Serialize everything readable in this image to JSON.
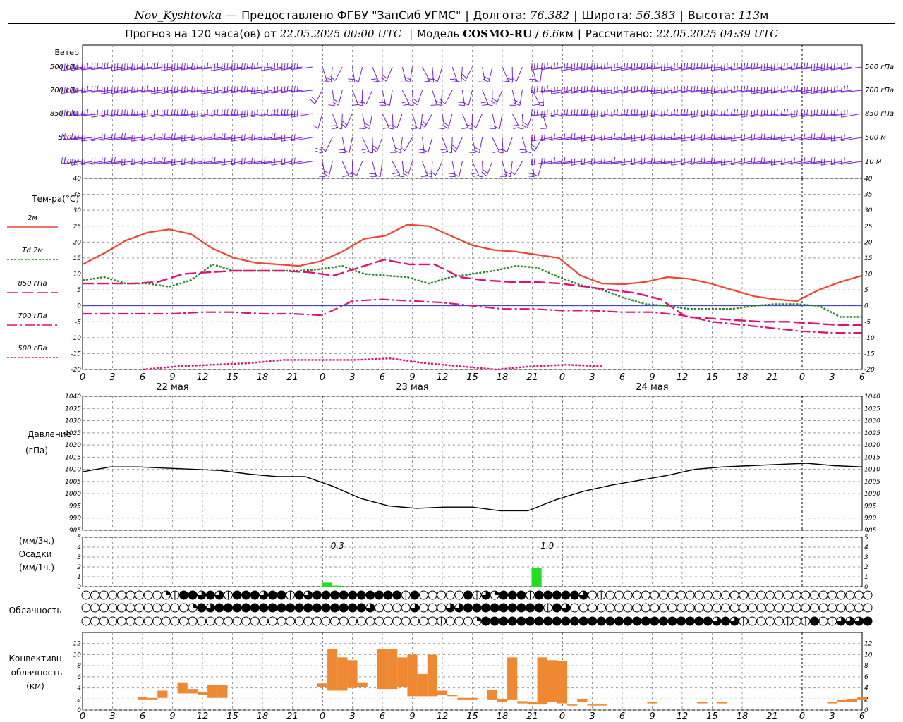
{
  "header": {
    "station": "Nov_Kyshtovka",
    "dash": "—",
    "provider": "Предоставлено ФГБУ \"ЗапСиб УГМС\"",
    "lon_label": "Долгота:",
    "lon_value": "76.382",
    "lat_label": "Широта:",
    "lat_value": "56.383",
    "alt_label": "Высота:",
    "alt_value": "113",
    "alt_unit": "м",
    "forecast_prefix": "Прогноз на 120 часа(ов) от",
    "forecast_start": "22.05.2025 00:00 UTC",
    "model_label": "Модель",
    "model_name": "COSMO-RU",
    "model_res": "6.6",
    "model_res_unit": "км",
    "calc_label": "Рассчитано:",
    "calc_time": "22.05.2025 04:39 UTC"
  },
  "colors": {
    "t2m": "#ee4433",
    "td2m": "#228822",
    "t850": "#dd1177",
    "t700": "#dd1177",
    "t500": "#dd1177",
    "pressure": "#000000",
    "precip": "#22dd22",
    "convective": "#ee8833",
    "wind": "#7722cc",
    "grid": "#999999"
  },
  "chart_data": [
    {
      "type": "line",
      "panel": "wind",
      "title": "Ветер",
      "levels": [
        "500 гПа",
        "700 гПа",
        "850 гПа",
        "500 м",
        "10 м"
      ]
    },
    {
      "type": "line",
      "panel": "temperature",
      "ylabel": "Тем-ра(°C)",
      "ylim": [
        -20,
        40
      ],
      "yticks": [
        40,
        35,
        30,
        25,
        20,
        15,
        10,
        5,
        0,
        -5,
        -10,
        -15,
        -20
      ],
      "x_hours": [
        0,
        3,
        6,
        9,
        12,
        15,
        18,
        21,
        24,
        27,
        30,
        33,
        36,
        39,
        42,
        45,
        48,
        51,
        54,
        57,
        60,
        63,
        66,
        69,
        72,
        75,
        78
      ],
      "x_ticks": [
        "0",
        "3",
        "6",
        "9",
        "12",
        "15",
        "18",
        "21",
        "0",
        "3",
        "6",
        "9",
        "12",
        "15",
        "18",
        "21",
        "0",
        "3",
        "6",
        "9",
        "12",
        "15",
        "18",
        "21",
        "0",
        "3",
        "6"
      ],
      "day_labels": [
        "22 мая",
        "23 мая",
        "24 мая"
      ],
      "series": [
        {
          "name": "2м",
          "values": [
            13,
            16.5,
            20.5,
            23,
            24,
            22.5,
            18,
            15,
            13.5,
            13,
            12.5,
            14,
            17,
            21,
            22,
            25.5,
            25,
            22,
            19,
            17.5,
            17,
            16,
            15,
            9.5,
            7,
            6.8,
            7.5,
            9,
            8.5,
            7,
            5,
            3,
            2,
            1.5,
            5,
            7.5,
            9.5
          ]
        },
        {
          "name": "Td 2м",
          "values": [
            8,
            9,
            7,
            7,
            6,
            8,
            13,
            11,
            11,
            11,
            11,
            11.5,
            12.5,
            10,
            9.5,
            9,
            7,
            9,
            10,
            11,
            12.5,
            12,
            9,
            6.5,
            5,
            2.5,
            0.5,
            0,
            -1,
            -1,
            -1,
            0,
            0.5,
            0.5,
            0,
            -3.5,
            -3.5
          ]
        },
        {
          "name": "850 гПа",
          "values": [
            7,
            7,
            7,
            7.5,
            10,
            10.5,
            11,
            11,
            11,
            10.5,
            9.5,
            12,
            14.5,
            13,
            13,
            9,
            8,
            7.5,
            7.5,
            7,
            6,
            5,
            4,
            2,
            -3.5,
            -4,
            -4.5,
            -5,
            -5,
            -5.5,
            -6,
            -6
          ]
        },
        {
          "name": "700 гПа",
          "values": [
            -2.5,
            -2.5,
            -2.5,
            -2.5,
            -2,
            -2,
            -2.5,
            -2.5,
            -3,
            1.5,
            2,
            1.5,
            1,
            0,
            -1,
            -1,
            -1.5,
            -1.5,
            -2,
            -2,
            -3,
            -5,
            -6,
            -7,
            -8,
            -8.5,
            -8.5
          ]
        },
        {
          "name": "500 гПа",
          "values": [
            -20,
            -19,
            -18.5,
            -18,
            -17,
            -17,
            -17,
            -16.5,
            -18,
            -19,
            -20,
            -19,
            -18.5,
            -19
          ]
        }
      ]
    },
    {
      "type": "line",
      "panel": "pressure",
      "ylabel": "Давление",
      "yunit": "(гПа)",
      "ylim": [
        985,
        1040
      ],
      "yticks": [
        1040,
        1035,
        1030,
        1025,
        1020,
        1015,
        1010,
        1005,
        1000,
        995,
        990,
        985
      ],
      "series": [
        {
          "name": "",
          "values": [
            1009,
            1011,
            1011,
            1010.5,
            1010,
            1009.5,
            1008,
            1007,
            1007,
            1003,
            998,
            995,
            994,
            994.5,
            994.5,
            993,
            993,
            997.5,
            1001,
            1003.5,
            1005.5,
            1007.5,
            1010,
            1011,
            1011.5,
            1012,
            1012.5,
            1011.5,
            1011
          ]
        }
      ]
    },
    {
      "type": "bar",
      "panel": "precipitation",
      "ylabel": "Осадки",
      "unit_3h": "(мм/3ч.)",
      "unit_1h": "(мм/1ч.)",
      "ylim": [
        0,
        5
      ],
      "yticks": [
        5,
        4,
        3,
        2,
        1,
        0
      ],
      "annotations": [
        {
          "hour": 24,
          "text": "0.3"
        },
        {
          "hour": 45,
          "text": "1.9"
        }
      ],
      "bars": [
        {
          "hour": 24,
          "value": 0.4
        },
        {
          "hour": 25,
          "value": 0.1
        },
        {
          "hour": 45,
          "value": 1.9
        }
      ]
    },
    {
      "type": "table",
      "panel": "cloudiness",
      "label": "Облачность",
      "rows": [
        [
          0,
          0,
          0,
          0,
          0,
          0,
          0,
          0,
          0,
          2,
          1,
          4,
          4,
          3,
          4,
          3,
          1,
          4,
          4,
          4,
          3,
          4,
          4,
          1,
          4,
          3,
          4,
          4,
          4,
          4,
          4,
          4,
          4,
          4,
          4,
          4,
          1,
          4,
          0,
          0,
          0,
          0,
          0,
          4,
          1,
          3,
          2,
          4,
          4,
          4,
          1,
          4,
          4,
          4,
          4,
          4,
          3,
          0,
          1,
          0,
          0,
          0,
          0,
          0,
          0,
          0,
          0,
          0,
          0,
          0,
          0,
          0,
          0,
          0,
          0,
          0,
          0,
          0,
          0,
          0,
          0,
          0,
          0,
          0,
          0,
          0,
          0,
          0,
          0
        ],
        [
          0,
          0,
          0,
          0,
          0,
          0,
          0,
          0,
          0,
          0,
          0,
          0,
          2,
          4,
          3,
          4,
          4,
          4,
          4,
          4,
          4,
          4,
          4,
          4,
          4,
          4,
          4,
          4,
          4,
          4,
          4,
          4,
          3,
          0,
          0,
          0,
          0,
          3,
          0,
          0,
          0,
          3,
          3,
          4,
          4,
          4,
          4,
          4,
          4,
          4,
          4,
          4,
          1,
          4,
          3,
          0,
          0,
          0,
          0,
          0,
          0,
          0,
          0,
          0,
          0,
          0,
          0,
          0,
          0,
          0,
          0,
          0,
          0,
          0,
          0,
          0,
          0,
          0,
          0,
          0,
          0,
          0,
          0,
          0,
          0,
          0,
          0,
          0,
          0
        ],
        [
          0,
          0,
          0,
          0,
          0,
          0,
          0,
          0,
          0,
          0,
          0,
          0,
          0,
          0,
          0,
          0,
          0,
          0,
          0,
          0,
          0,
          0,
          0,
          0,
          0,
          0,
          0,
          0,
          0,
          0,
          0,
          0,
          0,
          0,
          0,
          0,
          0,
          0,
          0,
          0,
          1,
          0,
          0,
          0,
          2,
          4,
          4,
          4,
          4,
          4,
          4,
          4,
          4,
          4,
          4,
          4,
          4,
          4,
          4,
          4,
          4,
          4,
          4,
          4,
          4,
          4,
          4,
          4,
          4,
          4,
          4,
          3,
          4,
          3,
          1,
          0,
          0,
          1,
          0,
          1,
          0,
          1,
          4,
          0,
          1,
          3,
          3,
          3,
          4
        ]
      ]
    },
    {
      "type": "bar",
      "panel": "convective",
      "ylabel": "Конвективн.",
      "ylabel2": "облачность",
      "yunit": "(км)",
      "ylim": [
        0,
        14
      ],
      "yticks": [
        12,
        10,
        8,
        6,
        4,
        2,
        0
      ],
      "bars": [
        {
          "hour": 6,
          "bottom": 1.8,
          "top": 2.3
        },
        {
          "hour": 7,
          "bottom": 1.8,
          "top": 2.2
        },
        {
          "hour": 8,
          "bottom": 2.2,
          "top": 3.5
        },
        {
          "hour": 10,
          "bottom": 3,
          "top": 5
        },
        {
          "hour": 11,
          "bottom": 3,
          "top": 3.8
        },
        {
          "hour": 12,
          "bottom": 2.8,
          "top": 3.2
        },
        {
          "hour": 13,
          "bottom": 2.2,
          "top": 4.5
        },
        {
          "hour": 14,
          "bottom": 2.2,
          "top": 4.5
        },
        {
          "hour": 24,
          "bottom": 4.2,
          "top": 4.8
        },
        {
          "hour": 25,
          "bottom": 3.5,
          "top": 11
        },
        {
          "hour": 26,
          "bottom": 3.5,
          "top": 9.5
        },
        {
          "hour": 27,
          "bottom": 4,
          "top": 9
        },
        {
          "hour": 28,
          "bottom": 4.2,
          "top": 5
        },
        {
          "hour": 30,
          "bottom": 3.8,
          "top": 11
        },
        {
          "hour": 31,
          "bottom": 3.8,
          "top": 11
        },
        {
          "hour": 32,
          "bottom": 4.2,
          "top": 9.5
        },
        {
          "hour": 33,
          "bottom": 2.5,
          "top": 10
        },
        {
          "hour": 34,
          "bottom": 2.5,
          "top": 6.5
        },
        {
          "hour": 35,
          "bottom": 2.5,
          "top": 10
        },
        {
          "hour": 36,
          "bottom": 2.8,
          "top": 3.5
        },
        {
          "hour": 37,
          "bottom": 2.5,
          "top": 2.8
        },
        {
          "hour": 38,
          "bottom": 1.8,
          "top": 2.2
        },
        {
          "hour": 39,
          "bottom": 1.8,
          "top": 2.2
        },
        {
          "hour": 41,
          "bottom": 1.8,
          "top": 3.6
        },
        {
          "hour": 42,
          "bottom": 1.5,
          "top": 2
        },
        {
          "hour": 43,
          "bottom": 1.8,
          "top": 9.5
        },
        {
          "hour": 44,
          "bottom": 1.2,
          "top": 1.6
        },
        {
          "hour": 45,
          "bottom": 1,
          "top": 1.4
        },
        {
          "hour": 46,
          "bottom": 1,
          "top": 9.5
        },
        {
          "hour": 47,
          "bottom": 1.5,
          "top": 9
        },
        {
          "hour": 48,
          "bottom": 1.2,
          "top": 8.8
        },
        {
          "hour": 49,
          "bottom": 0.8,
          "top": 1
        },
        {
          "hour": 50,
          "bottom": 1.5,
          "top": 2
        },
        {
          "hour": 51,
          "bottom": 0.8,
          "top": 1
        },
        {
          "hour": 52,
          "bottom": 0.8,
          "top": 1
        },
        {
          "hour": 57,
          "bottom": 1.2,
          "top": 1.5
        },
        {
          "hour": 62,
          "bottom": 1.2,
          "top": 1.5
        },
        {
          "hour": 64,
          "bottom": 1.2,
          "top": 1.5
        },
        {
          "hour": 75,
          "bottom": 1.2,
          "top": 1.5
        },
        {
          "hour": 76,
          "bottom": 1.5,
          "top": 1.8
        },
        {
          "hour": 77,
          "bottom": 1.5,
          "top": 2
        },
        {
          "hour": 78,
          "bottom": 1.8,
          "top": 2.3
        }
      ]
    }
  ]
}
